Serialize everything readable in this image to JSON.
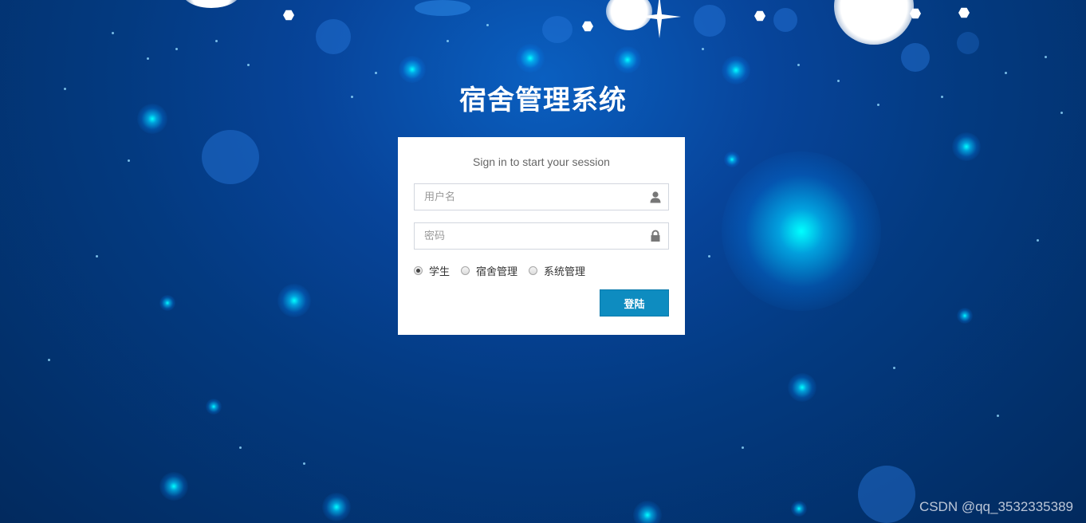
{
  "page": {
    "title": "宿舍管理系统"
  },
  "login": {
    "message": "Sign in to start your session",
    "username_placeholder": "用户名",
    "password_placeholder": "密码",
    "user_icon": "user-icon",
    "lock_icon": "lock-icon",
    "roles": [
      {
        "label": "学生",
        "checked": true
      },
      {
        "label": "宿舍管理",
        "checked": false
      },
      {
        "label": "系统管理",
        "checked": false
      }
    ],
    "submit_label": "登陆"
  },
  "watermark": "CSDN @qq_3532335389",
  "colors": {
    "button": "#0e8cc0",
    "background": "#033a80",
    "box": "#ffffff"
  }
}
